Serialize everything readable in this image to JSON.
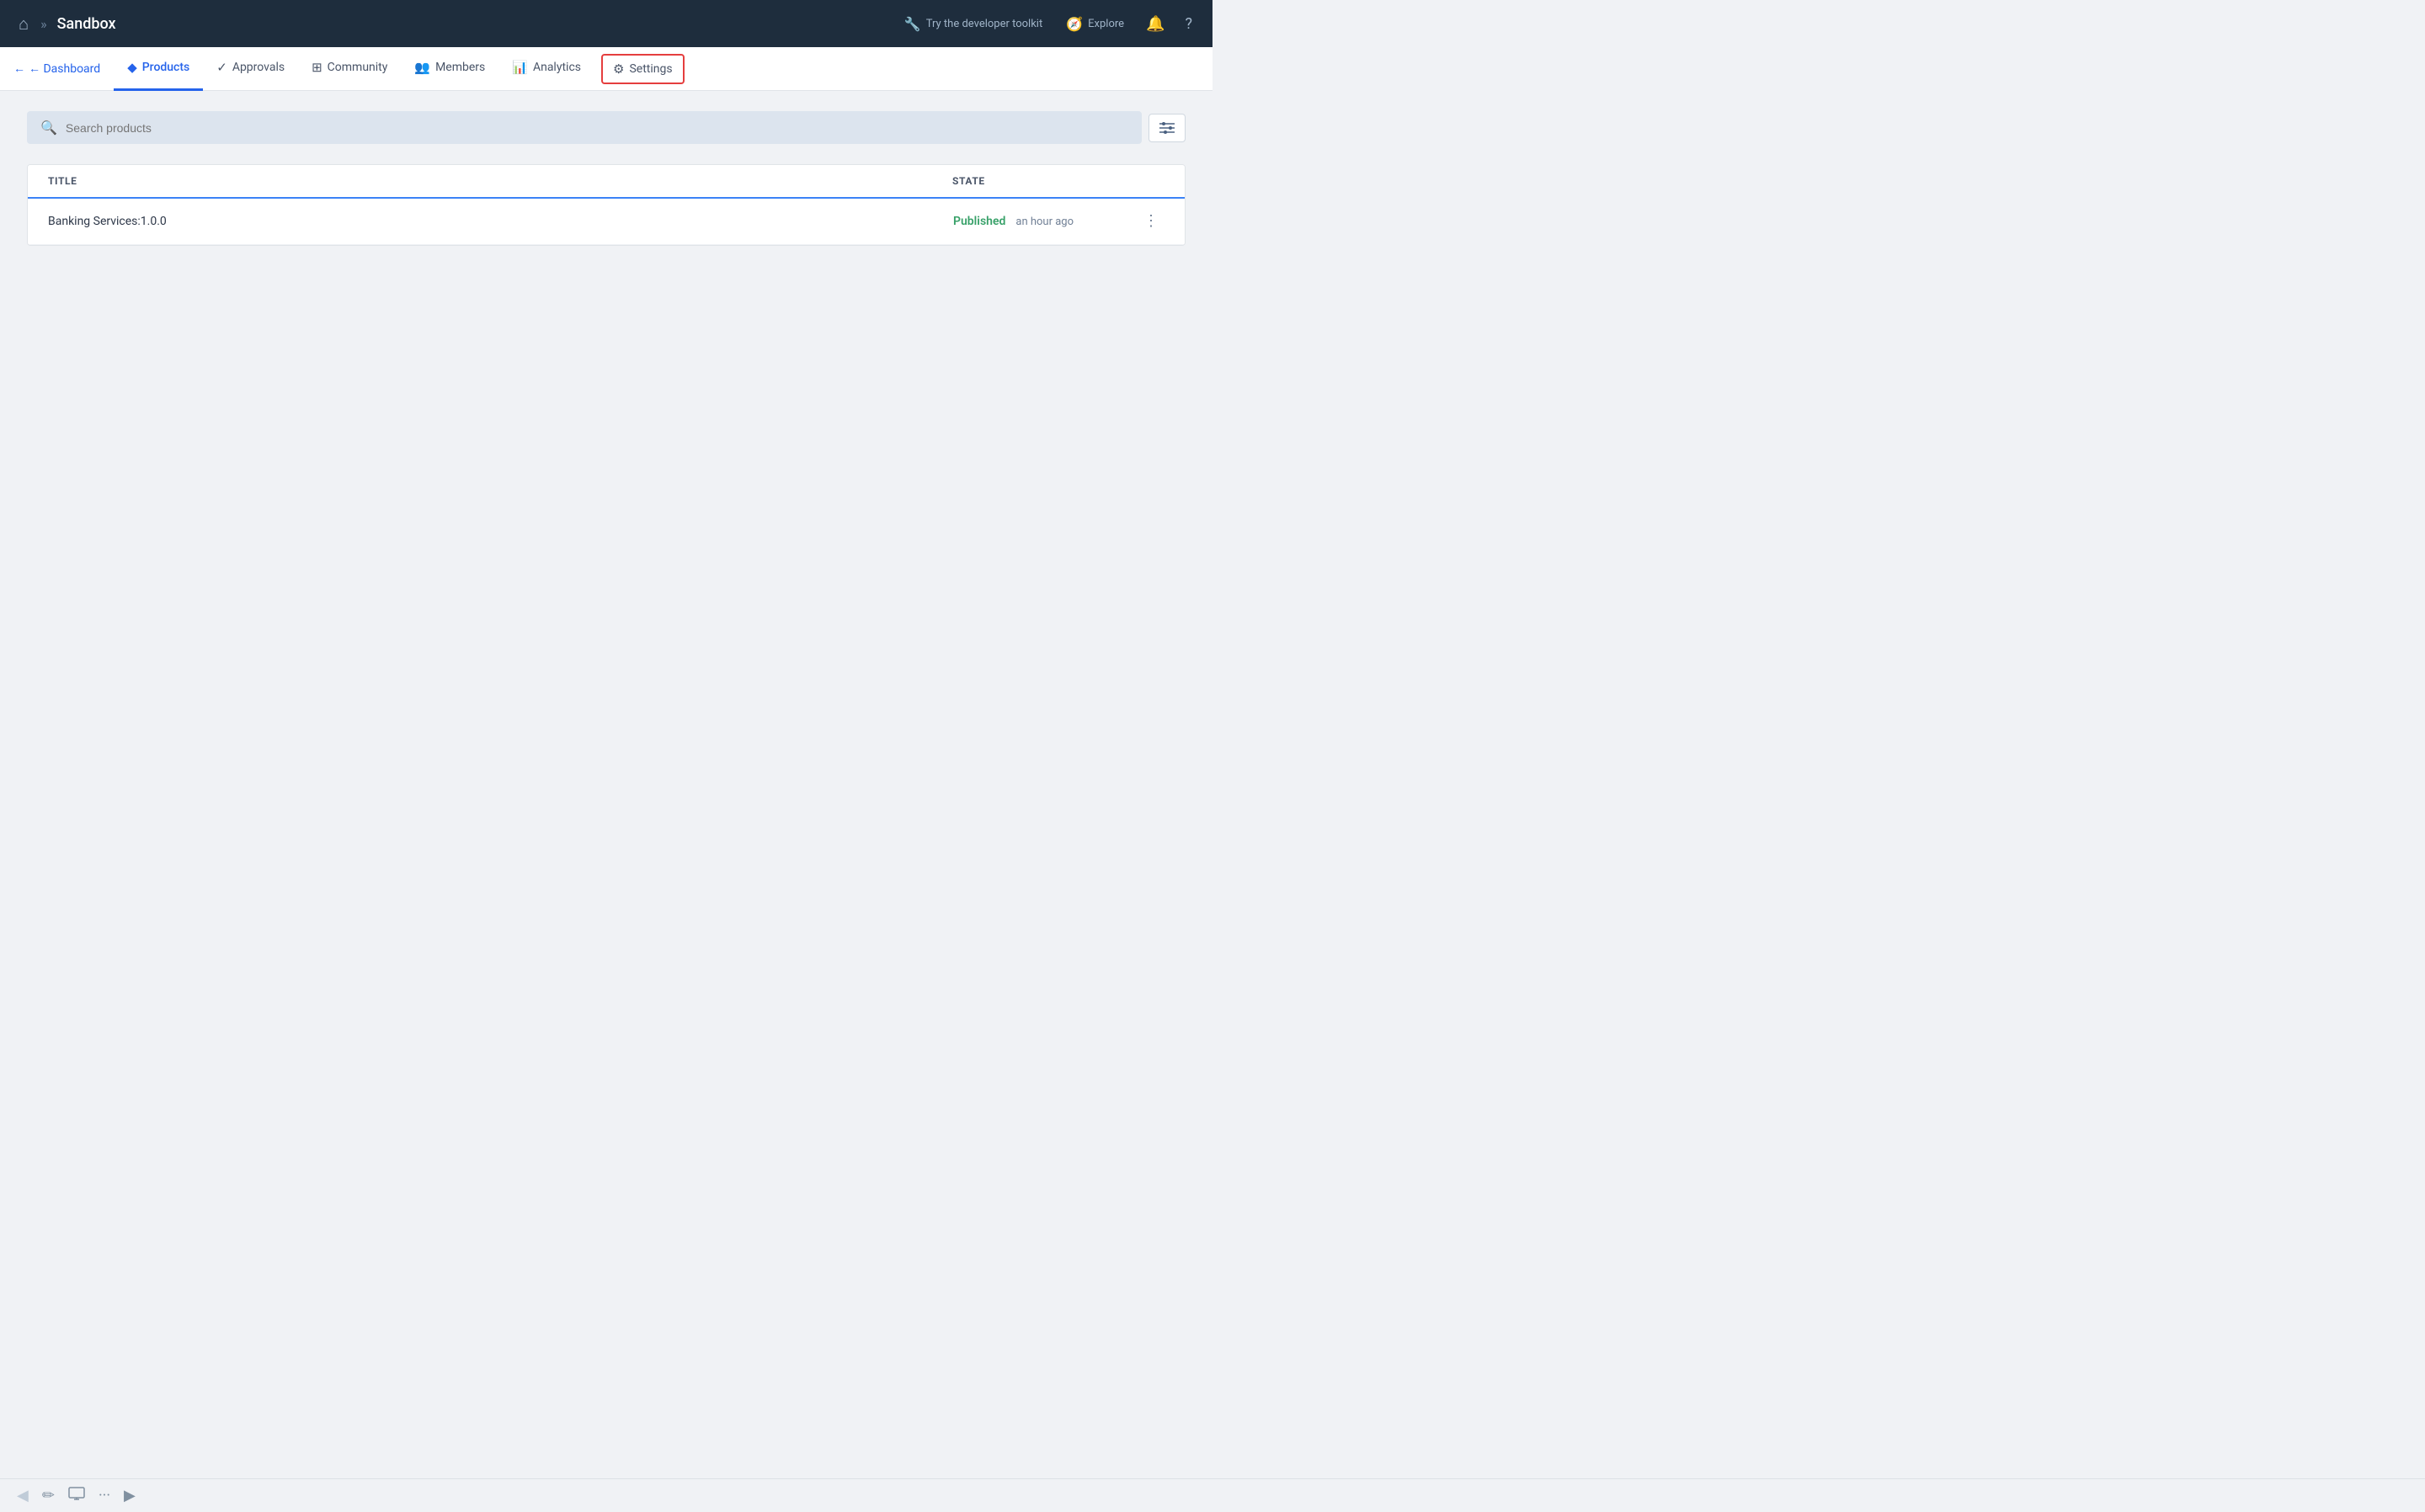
{
  "topNav": {
    "homeIcon": "⌂",
    "chevron": "»",
    "title": "Sandbox",
    "toolkitLabel": "Try the developer toolkit",
    "toolkitIcon": "🔧",
    "exploreLabel": "Explore",
    "exploreIcon": "🧭",
    "bellIcon": "🔔",
    "helpIcon": "?"
  },
  "tabs": {
    "back": "← Dashboard",
    "items": [
      {
        "id": "products",
        "label": "Products",
        "icon": "◆",
        "active": true
      },
      {
        "id": "approvals",
        "label": "Approvals",
        "icon": "✓"
      },
      {
        "id": "community",
        "label": "Community",
        "icon": "⊞"
      },
      {
        "id": "members",
        "label": "Members",
        "icon": "👥"
      },
      {
        "id": "analytics",
        "label": "Analytics",
        "icon": "📊"
      },
      {
        "id": "settings",
        "label": "Settings",
        "icon": "⚙",
        "highlighted": true
      }
    ]
  },
  "search": {
    "placeholder": "Search products",
    "searchIcon": "🔍",
    "filterIcon": "⚙"
  },
  "table": {
    "columns": {
      "title": "TITLE",
      "state": "STATE"
    },
    "rows": [
      {
        "title": "Banking Services:1.0.0",
        "status": "Published",
        "timeAgo": "an hour ago"
      }
    ]
  },
  "bottomBar": {
    "backIcon": "◀",
    "editIcon": "✏",
    "monitorIcon": "🖥",
    "moreIcon": "···",
    "forwardIcon": "▶"
  }
}
